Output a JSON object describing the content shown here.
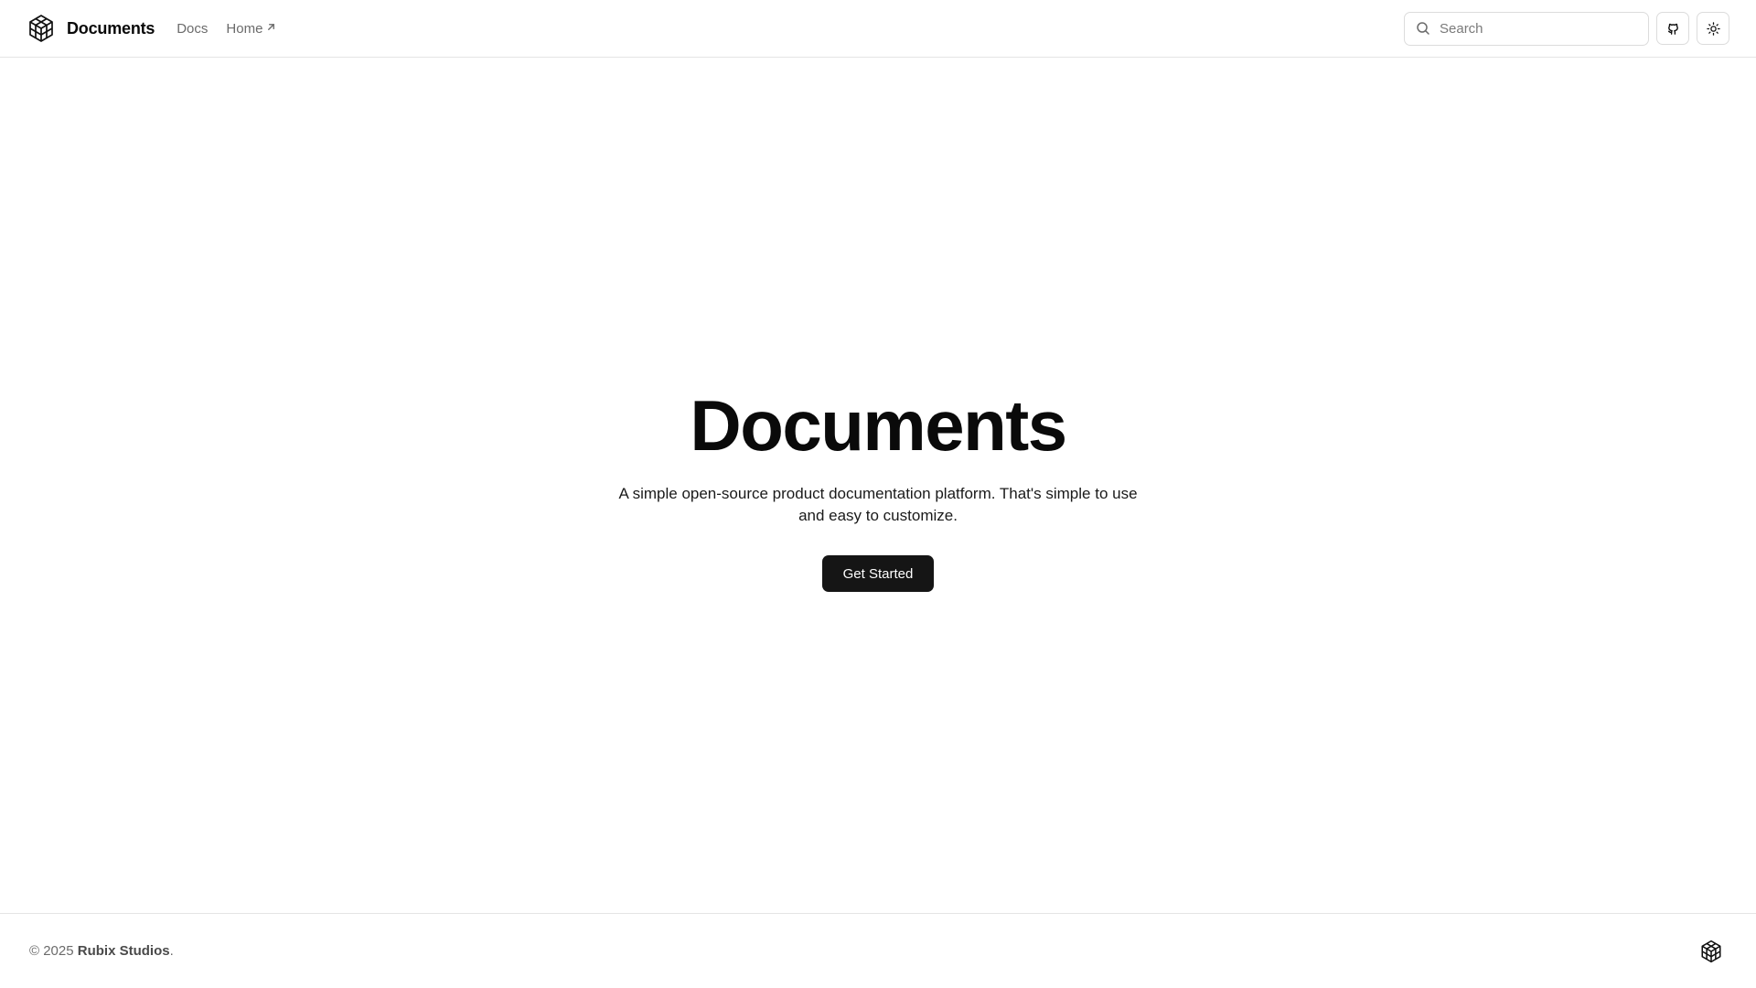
{
  "header": {
    "brand": {
      "logo_icon": "cube-logo-icon",
      "name": "Documents"
    },
    "nav": [
      {
        "label": "Docs",
        "external": false
      },
      {
        "label": "Home",
        "external": true,
        "external_icon": "arrow-up-right-icon"
      }
    ],
    "search": {
      "icon": "search-icon",
      "placeholder": "Search",
      "value": ""
    },
    "actions": [
      {
        "icon": "github-icon"
      },
      {
        "icon": "sun-icon"
      }
    ]
  },
  "hero": {
    "title": "Documents",
    "subtitle": "A simple open-source product documentation platform. That's simple to use and easy to customize.",
    "cta_label": "Get Started"
  },
  "footer": {
    "copyright_prefix": "© 2025 ",
    "owner": "Rubix Studios",
    "suffix": ".",
    "logo_icon": "cube-logo-icon"
  },
  "colors": {
    "text_primary": "#0a0a0a",
    "text_muted": "#6b6b6b",
    "border": "#e5e5e5",
    "button_bg": "#151515",
    "button_text": "#ffffff",
    "background": "#ffffff"
  }
}
